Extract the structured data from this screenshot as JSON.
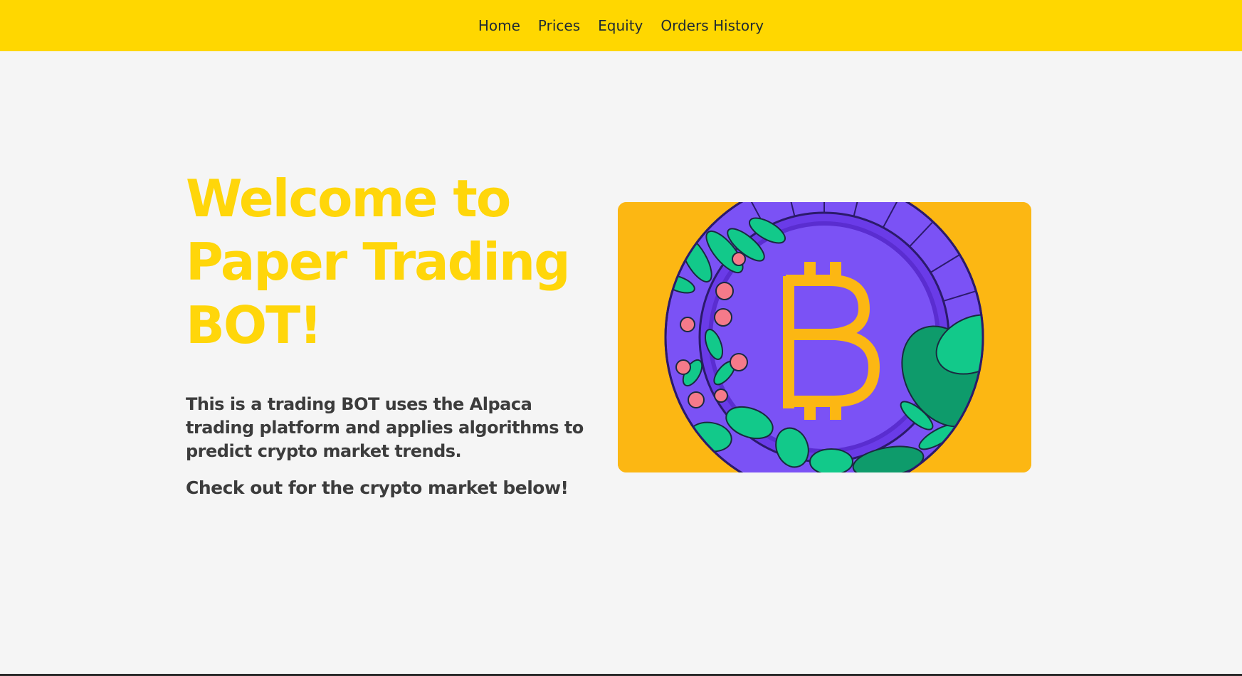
{
  "nav": {
    "items": [
      {
        "label": "Home"
      },
      {
        "label": "Prices"
      },
      {
        "label": "Equity"
      },
      {
        "label": "Orders History"
      }
    ]
  },
  "hero": {
    "title_line1": "Welcome to",
    "title_line2": "Paper Trading",
    "title_line3": "BOT!",
    "description": "This is a trading BOT uses the Alpaca trading platform and applies algorithms to predict crypto market trends.",
    "cta": "Check out for the crypto market below!",
    "image_icon": "bitcoin-coin-illustration",
    "title_color": "#ffd60a",
    "accent_color": "#ffd700"
  }
}
